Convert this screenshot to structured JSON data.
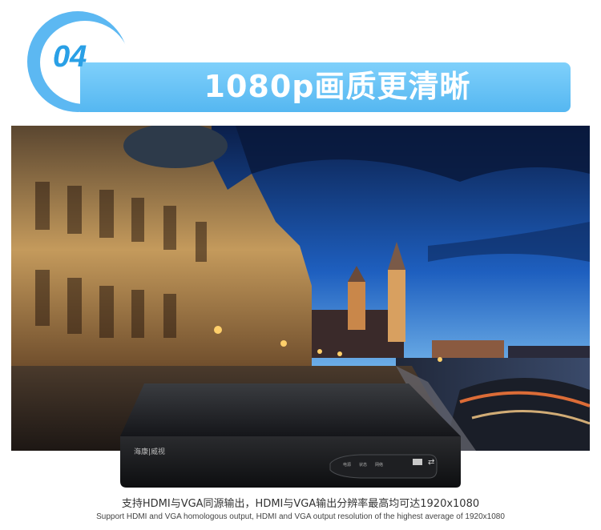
{
  "header": {
    "number": "04",
    "title": "1080p画质更清晰"
  },
  "device": {
    "brand_label": "海康|威视",
    "indicators": [
      "电源",
      "状态",
      "网络"
    ],
    "usb_symbol": "⇄"
  },
  "caption": {
    "chinese": "支持HDMI与VGA同源输出，HDMI与VGA输出分辨率最高均可达1920x1080",
    "english": "Support HDMI and VGA homologous output, HDMI and VGA output resolution of the highest average of 1920x1080"
  }
}
